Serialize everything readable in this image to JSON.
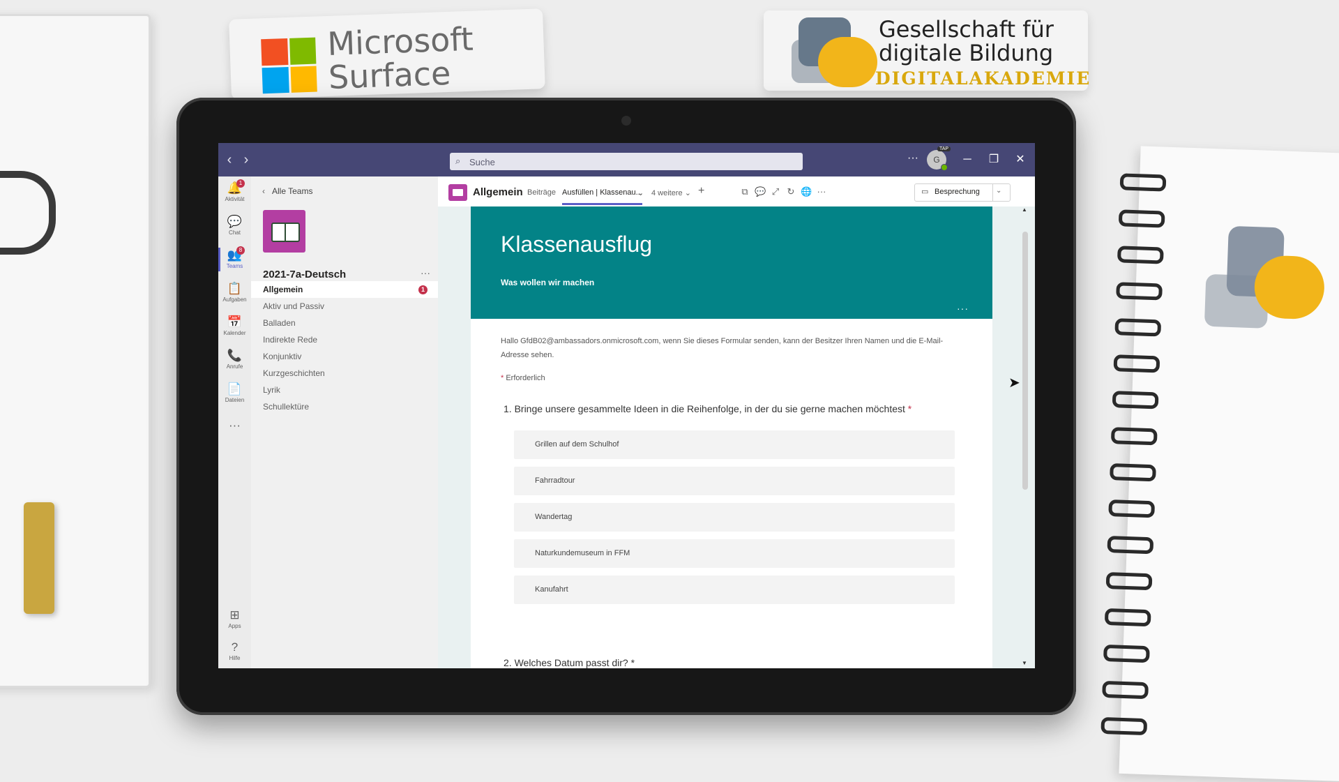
{
  "background": {
    "brand_ms": "Microsoft Surface",
    "brand_ms_colors": [
      "#f25022",
      "#7fba00",
      "#00a4ef",
      "#ffb900"
    ],
    "brand_gfdb_title": "Gesellschaft für digitale Bildung",
    "brand_gfdb_sub": "DIGITALAKADEMIE"
  },
  "titlebar": {
    "back_icon": "‹",
    "forward_icon": "›",
    "search_placeholder": "Suche",
    "more": "···",
    "avatar_initial": "G",
    "avatar_badge": "TAP",
    "minimize": "─",
    "maximize": "❐",
    "close": "✕"
  },
  "rail": {
    "items": [
      {
        "label": "Aktivität",
        "icon": "🔔",
        "badge": "1"
      },
      {
        "label": "Chat",
        "icon": "💬"
      },
      {
        "label": "Teams",
        "icon": "👥",
        "badge": "8",
        "active": true
      },
      {
        "label": "Aufgaben",
        "icon": "📋"
      },
      {
        "label": "Kalender",
        "icon": "📅"
      },
      {
        "label": "Anrufe",
        "icon": "📞"
      },
      {
        "label": "Dateien",
        "icon": "📄"
      }
    ],
    "more": "···",
    "apps": {
      "label": "Apps",
      "icon": "⊞"
    },
    "help": {
      "label": "Hilfe",
      "icon": "?"
    }
  },
  "team": {
    "back_label": "Alle Teams",
    "name": "2021-7a-Deutsch",
    "more": "···",
    "channels": [
      {
        "label": "Allgemein",
        "active": true,
        "badge": "1"
      },
      {
        "label": "Aktiv und Passiv"
      },
      {
        "label": "Balladen"
      },
      {
        "label": "Indirekte Rede"
      },
      {
        "label": "Konjunktiv"
      },
      {
        "label": "Kurzgeschichten"
      },
      {
        "label": "Lyrik"
      },
      {
        "label": "Schullektüre"
      }
    ]
  },
  "header": {
    "channel_title": "Allgemein",
    "tabs": [
      "Beiträge",
      "Ausfüllen | Klassenau...",
      "4 weitere"
    ],
    "add": "+",
    "meeting_label": "Besprechung"
  },
  "form": {
    "title": "Klassenausflug",
    "description": "Was wollen wir machen",
    "more": "···",
    "note": "Hallo GfdB02@ambassadors.onmicrosoft.com, wenn Sie dieses Formular senden, kann der Besitzer Ihren Namen und die E-Mail-Adresse sehen.",
    "required_star": "*",
    "required_label": "Erforderlich",
    "q1": "1. Bringe unsere gesammelte Ideen in die Reihenfolge, in der du sie gerne machen möchtest",
    "q1_options": [
      "Grillen auf dem Schulhof",
      "Fahrradtour",
      "Wandertag",
      "Naturkundemuseum in FFM",
      "Kanufahrt"
    ],
    "q2": "2. Welches Datum passt dir?"
  },
  "colors": {
    "titlebar": "#464775",
    "accent": "#5b5fc7",
    "form_banner": "#038387",
    "badge": "#c4314b",
    "team_avatar": "#b33ea2"
  }
}
